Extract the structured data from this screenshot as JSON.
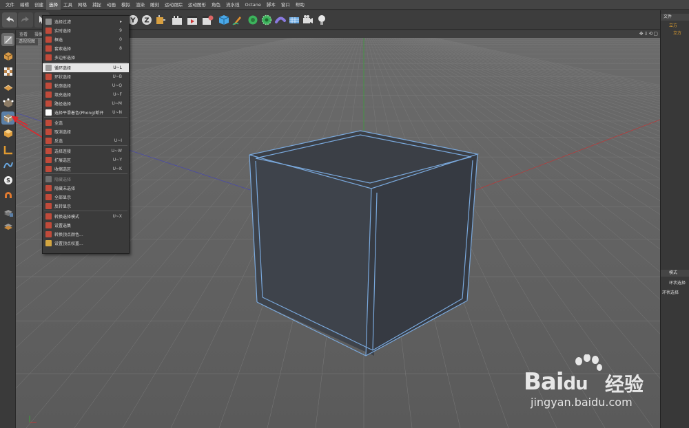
{
  "menubar": {
    "items": [
      "文件",
      "编辑",
      "创建",
      "选择",
      "工具",
      "网格",
      "捕捉",
      "动画",
      "模拟",
      "渲染",
      "雕刻",
      "运动跟踪",
      "运动图形",
      "角色",
      "流水线",
      "Octane",
      "脚本",
      "窗口",
      "帮助"
    ],
    "active_index": 3
  },
  "viewport": {
    "header_items": [
      "查看",
      "摄像机"
    ],
    "label": "透视视图",
    "nav_icons": "✥⇩⟲▢"
  },
  "dropdown": {
    "items": [
      {
        "label": "选择过滤",
        "shortcut": "",
        "arrow": "▸",
        "color": "#8c8c8c"
      },
      {
        "label": "实时选择",
        "shortcut": "9",
        "color": "#c14a3a"
      },
      {
        "label": "框选",
        "shortcut": "0",
        "color": "#c14a3a"
      },
      {
        "label": "套索选择",
        "shortcut": "8",
        "color": "#c14a3a"
      },
      {
        "label": "多边形选择",
        "shortcut": "",
        "color": "#c14a3a"
      },
      {
        "label": "循环选择",
        "shortcut": "U~L",
        "color": "#9a9a9a",
        "highlight": true
      },
      {
        "label": "环状选择",
        "shortcut": "U~B",
        "color": "#c14a3a"
      },
      {
        "label": "轮廓选择",
        "shortcut": "U~Q",
        "color": "#c14a3a"
      },
      {
        "label": "填充选择",
        "shortcut": "U~F",
        "color": "#c14a3a"
      },
      {
        "label": "路径选择",
        "shortcut": "U~M",
        "color": "#c14a3a"
      },
      {
        "label": "选择平滑着色(Phong)断开",
        "shortcut": "U~N",
        "color": "#ffffff"
      },
      {
        "label": "全选",
        "shortcut": "",
        "color": "#c14a3a"
      },
      {
        "label": "取消选择",
        "shortcut": "",
        "color": "#c14a3a"
      },
      {
        "label": "反选",
        "shortcut": "U~I",
        "color": "#c14a3a"
      },
      {
        "label": "选择连接",
        "shortcut": "U~W",
        "color": "#c14a3a"
      },
      {
        "label": "扩展选区",
        "shortcut": "U~Y",
        "color": "#c14a3a"
      },
      {
        "label": "收缩选区",
        "shortcut": "U~K",
        "color": "#c14a3a"
      },
      {
        "label": "隐藏选择",
        "shortcut": "",
        "color": "#6f6f6f",
        "dim": true
      },
      {
        "label": "隐藏未选择",
        "shortcut": "",
        "color": "#c14a3a"
      },
      {
        "label": "全部显示",
        "shortcut": "",
        "color": "#c14a3a"
      },
      {
        "label": "反转显示",
        "shortcut": "",
        "color": "#c14a3a"
      },
      {
        "label": "转换选择模式",
        "shortcut": "U~X",
        "color": "#c14a3a"
      },
      {
        "label": "设置选集",
        "shortcut": "",
        "color": "#c14a3a"
      },
      {
        "label": "转换顶点颜色...",
        "shortcut": "",
        "color": "#c14a3a"
      },
      {
        "label": "设置顶点权重...",
        "shortcut": "",
        "color": "#d4a640"
      }
    ]
  },
  "rightpanel": {
    "top_tab": "文件",
    "object_name": "立方",
    "attr_tab": "模式",
    "attr_item": "环状选择",
    "attr_item2": "环状选择"
  },
  "watermark": {
    "brand": "Bai",
    "brand2": "du",
    "cn": "经验",
    "url": "jingyan.baidu.com"
  },
  "colors": {
    "accent": "#5b7fa6",
    "arrow": "#e0262b",
    "cube": "#3d4149",
    "cube_edge": "#7aa9dd"
  }
}
